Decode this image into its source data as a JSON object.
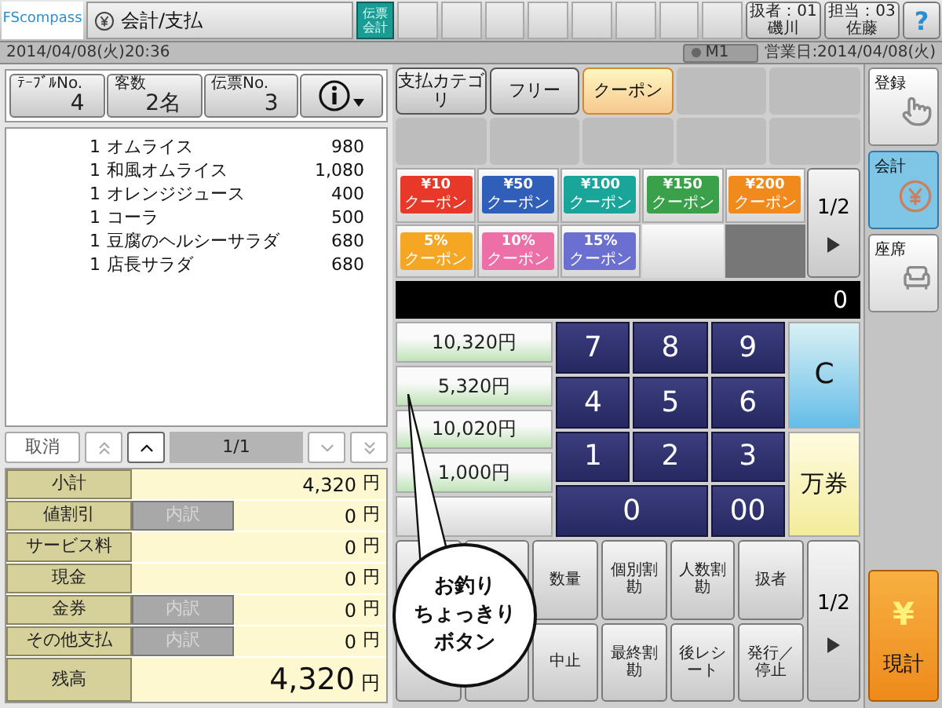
{
  "header": {
    "logo": "FScompass",
    "title": "会計/支払",
    "slip_button": [
      "伝票",
      "会計"
    ],
    "operator": {
      "label": "扱者：01",
      "name": "磯川"
    },
    "staff": {
      "label": "担当：03",
      "name": "佐藤"
    },
    "help": "?"
  },
  "status_bar": {
    "datetime": "2014/04/08(火)20:36",
    "mode": "M1",
    "business_date": "営業日:2014/04/08(火)"
  },
  "order_info": [
    {
      "label": "ﾃｰﾌﾞﾙNo.",
      "value": "4"
    },
    {
      "label": "客数",
      "value": "2名"
    },
    {
      "label": "伝票No.",
      "value": "3"
    }
  ],
  "items": [
    {
      "qty": "1",
      "name": "オムライス",
      "price": "980"
    },
    {
      "qty": "1",
      "name": "和風オムライス",
      "price": "1,080"
    },
    {
      "qty": "1",
      "name": "オレンジジュース",
      "price": "400"
    },
    {
      "qty": "1",
      "name": "コーラ",
      "price": "500"
    },
    {
      "qty": "1",
      "name": "豆腐のヘルシーサラダ",
      "price": "680"
    },
    {
      "qty": "1",
      "name": "店長サラダ",
      "price": "680"
    }
  ],
  "pager": {
    "cancel": "取消",
    "page": "1/1"
  },
  "summary": [
    {
      "label": "小計",
      "amount": "4,320",
      "unit": "円",
      "kind": "row"
    },
    {
      "label": "値割引",
      "detail": "内訳",
      "amount": "0",
      "unit": "円",
      "kind": "row"
    },
    {
      "label": "サービス料",
      "amount": "0",
      "unit": "円",
      "kind": "row"
    },
    {
      "label": "現金",
      "amount": "0",
      "unit": "円",
      "kind": "row"
    },
    {
      "label": "金券",
      "detail": "内訳",
      "amount": "0",
      "unit": "円",
      "kind": "row"
    },
    {
      "label": "その他支払",
      "detail": "内訳",
      "amount": "0",
      "unit": "円",
      "kind": "row"
    },
    {
      "label": "残高",
      "amount": "4,320",
      "unit": "円",
      "kind": "total"
    }
  ],
  "payment_categories": [
    {
      "label": "支払カテゴリ",
      "selected": false
    },
    {
      "label": "フリー",
      "selected": false
    },
    {
      "label": "クーポン",
      "selected": true
    }
  ],
  "coupons": [
    {
      "line1": "¥10",
      "line2": "クーポン",
      "color": "#e8382a"
    },
    {
      "line1": "¥50",
      "line2": "クーポン",
      "color": "#2f5fb8"
    },
    {
      "line1": "¥100",
      "line2": "クーポン",
      "color": "#1aa59a"
    },
    {
      "line1": "¥150",
      "line2": "クーポン",
      "color": "#3aa04a"
    },
    {
      "line1": "¥200",
      "line2": "クーポン",
      "color": "#f08a1c"
    },
    {
      "line1": "5%",
      "line2": "クーポン",
      "color": "#f5a623"
    },
    {
      "line1": "10%",
      "line2": "クーポン",
      "color": "#ec6fa8"
    },
    {
      "line1": "15%",
      "line2": "クーポン",
      "color": "#6a6fd0"
    }
  ],
  "coupon_page": "1/2",
  "display": "0",
  "quick_amounts": [
    "10,320円",
    "5,320円",
    "10,020円",
    "1,000円"
  ],
  "keypad": [
    {
      "label": "7",
      "wide": false
    },
    {
      "label": "8",
      "wide": false
    },
    {
      "label": "9",
      "wide": false
    },
    {
      "label": "4",
      "wide": false
    },
    {
      "label": "5",
      "wide": false
    },
    {
      "label": "6",
      "wide": false
    },
    {
      "label": "1",
      "wide": false
    },
    {
      "label": "2",
      "wide": false
    },
    {
      "label": "3",
      "wide": false
    },
    {
      "label": "0",
      "wide": true
    },
    {
      "label": "00",
      "wide": false
    }
  ],
  "clear": "C",
  "bill_button": "万券",
  "function_rows": [
    [
      "数量",
      "個別割勘",
      "人数割勘",
      "扱者"
    ],
    [
      "中止",
      "最終割勘",
      "後レシート",
      "発行／停止"
    ]
  ],
  "function_page": "1/2",
  "sidebar": [
    {
      "label": "登録",
      "selected": false,
      "kind": "register"
    },
    {
      "label": "会計",
      "selected": true,
      "kind": "checkout"
    },
    {
      "label": "座席",
      "selected": false,
      "kind": "seat"
    }
  ],
  "total_button": {
    "symbol": "¥",
    "label": "現計"
  },
  "callout": [
    "お釣り",
    "ちょっきり",
    "ボタン"
  ]
}
